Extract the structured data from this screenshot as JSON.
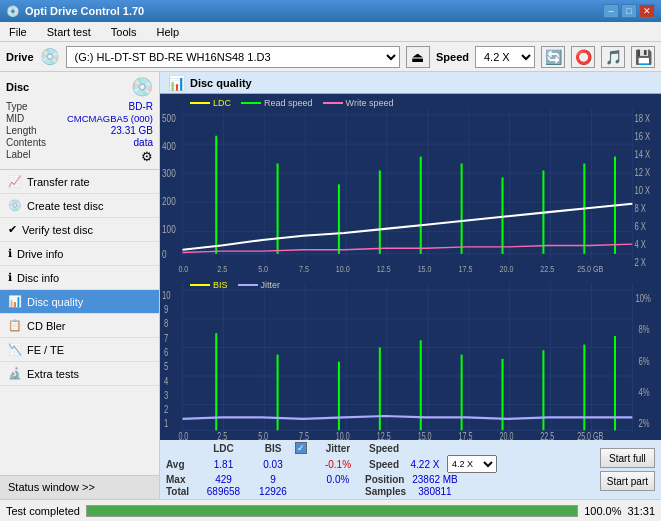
{
  "titleBar": {
    "title": "Opti Drive Control 1.70",
    "icon": "💿",
    "minBtn": "–",
    "maxBtn": "□",
    "closeBtn": "✕"
  },
  "menuBar": {
    "items": [
      "File",
      "Start test",
      "Tools",
      "Help"
    ]
  },
  "driveBar": {
    "driveLabel": "Drive",
    "driveIcon": "💿",
    "driveValue": "(G:)  HL-DT-ST BD-RE  WH16NS48 1.D3",
    "ejectLabel": "⏏",
    "speedLabel": "Speed",
    "speedValue": "4.2 X ▼",
    "icons": [
      "🔄",
      "⭕",
      "🎵",
      "💾"
    ]
  },
  "disc": {
    "title": "Disc",
    "typeLabel": "Type",
    "typeValue": "BD-R",
    "midLabel": "MID",
    "midValue": "CMCMAGBA5 (000)",
    "lengthLabel": "Length",
    "lengthValue": "23.31 GB",
    "contentsLabel": "Contents",
    "contentsValue": "data",
    "labelLabel": "Label",
    "labelValue": ""
  },
  "nav": {
    "items": [
      {
        "id": "transfer-rate",
        "label": "Transfer rate",
        "icon": "📈"
      },
      {
        "id": "create-test-disc",
        "label": "Create test disc",
        "icon": "💿"
      },
      {
        "id": "verify-test-disc",
        "label": "Verify test disc",
        "icon": "✔"
      },
      {
        "id": "drive-info",
        "label": "Drive info",
        "icon": "ℹ"
      },
      {
        "id": "disc-info",
        "label": "Disc info",
        "icon": "ℹ"
      },
      {
        "id": "disc-quality",
        "label": "Disc quality",
        "icon": "📊",
        "active": true
      },
      {
        "id": "cd-bler",
        "label": "CD Bler",
        "icon": "📋"
      },
      {
        "id": "fe-te",
        "label": "FE / TE",
        "icon": "📉"
      },
      {
        "id": "extra-tests",
        "label": "Extra tests",
        "icon": "🔬"
      }
    ],
    "statusWindow": "Status window >>"
  },
  "discQuality": {
    "title": "Disc quality",
    "chart1": {
      "legend": {
        "ldc": {
          "label": "LDC",
          "color": "#ffff00"
        },
        "readSpeed": {
          "label": "Read speed",
          "color": "#ffffff"
        },
        "writeSpeed": {
          "label": "Write speed",
          "color": "#ff69b4"
        }
      },
      "yAxisLeft": [
        "500",
        "400",
        "300",
        "200",
        "100",
        "0"
      ],
      "yAxisRight": [
        "18 X",
        "16 X",
        "14 X",
        "12 X",
        "10 X",
        "8 X",
        "6 X",
        "4 X",
        "2 X"
      ],
      "xAxis": [
        "0.0",
        "2.5",
        "5.0",
        "7.5",
        "10.0",
        "12.5",
        "15.0",
        "17.5",
        "20.0",
        "22.5",
        "25.0 GB"
      ]
    },
    "chart2": {
      "legend": {
        "bis": {
          "label": "BIS",
          "color": "#ffff00"
        },
        "jitter": {
          "label": "Jitter",
          "color": "#aaaaff"
        }
      },
      "yAxisLeft": [
        "10",
        "9",
        "8",
        "7",
        "6",
        "5",
        "4",
        "3",
        "2",
        "1"
      ],
      "yAxisRight": [
        "10%",
        "8%",
        "6%",
        "4%",
        "2%"
      ],
      "xAxis": [
        "0.0",
        "2.5",
        "5.0",
        "7.5",
        "10.0",
        "12.5",
        "15.0",
        "17.5",
        "20.0",
        "22.5",
        "25.0 GB"
      ]
    },
    "stats": {
      "headers": [
        "",
        "LDC",
        "BIS",
        "",
        "Jitter",
        "Speed",
        "",
        ""
      ],
      "avg": {
        "label": "Avg",
        "ldc": "1.81",
        "bis": "0.03",
        "jitter": "-0.1%",
        "speedLabel": "Speed",
        "speedVal": "4.22 X",
        "speedSelect": "4.2 X ▼"
      },
      "max": {
        "label": "Max",
        "ldc": "429",
        "bis": "9",
        "jitter": "0.0%",
        "positionLabel": "Position",
        "positionVal": "23862 MB"
      },
      "total": {
        "label": "Total",
        "ldc": "689658",
        "bis": "12926",
        "samplesLabel": "Samples",
        "samplesVal": "380811"
      },
      "jitterChecked": true,
      "startFull": "Start full",
      "startPart": "Start part"
    }
  },
  "statusBar": {
    "text": "Test completed",
    "progressPercent": 100,
    "progressLabel": "100.0%",
    "time": "31:31"
  }
}
